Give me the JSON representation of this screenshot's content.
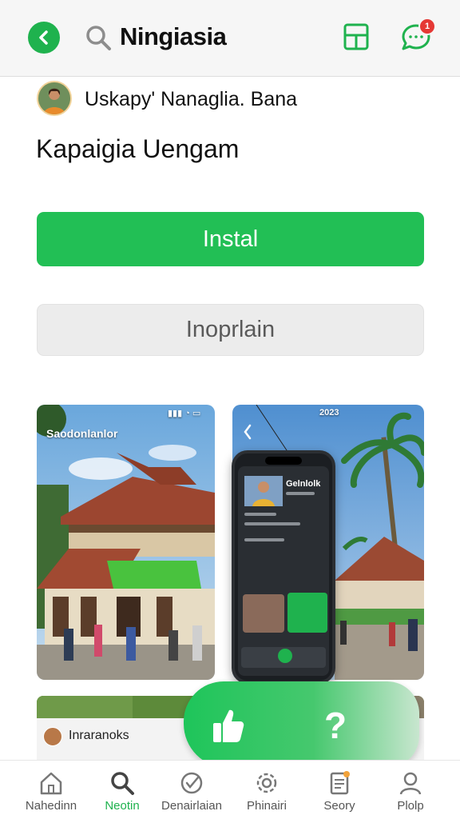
{
  "header": {
    "title": "Ningiasia",
    "icons": [
      "back-arrow-icon",
      "search-icon",
      "bookmark-icon",
      "chat-icon"
    ],
    "notification_count": "1"
  },
  "app": {
    "developer": "Uskapy' Nanaglia. Bana",
    "name": "Kapaigia Uengam"
  },
  "buttons": {
    "install_label": "Instal",
    "secondary_label": "Inoprlain"
  },
  "screenshots": {
    "left_caption": "Saodonlanlor",
    "right_year": "2023",
    "phone_title": "Gelnlolk"
  },
  "preview": {
    "label": "Inraranoks"
  },
  "floating_actions": {
    "icons": [
      "thumbs-up-icon",
      "question-mark-icon"
    ],
    "help_glyph": "?"
  },
  "nav": {
    "items": [
      {
        "label": "Nahedinn",
        "icon": "home-icon"
      },
      {
        "label": "Neotin",
        "icon": "search-icon"
      },
      {
        "label": "Denairlaian",
        "icon": "check-badge-icon"
      },
      {
        "label": "Phinairi",
        "icon": "settings-icon"
      },
      {
        "label": "Seory",
        "icon": "document-icon"
      },
      {
        "label": "Plolp",
        "icon": "profile-icon"
      }
    ],
    "active_index": 1
  },
  "colors": {
    "accent": "#22bf55",
    "badge": "#e53935",
    "secondary_button": "#ececec"
  }
}
